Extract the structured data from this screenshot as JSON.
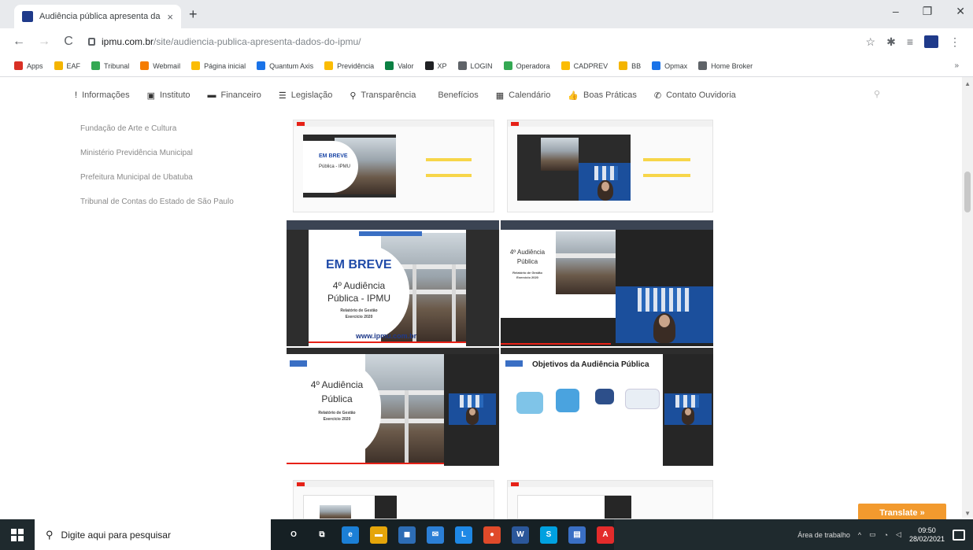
{
  "browser": {
    "tab_title": "Audiência pública apresenta da",
    "tab_close": "×",
    "new_tab": "+",
    "win_min": "–",
    "win_max": "❐",
    "win_close": "✕",
    "back": "←",
    "forward": "→",
    "reload": "C",
    "url_host": "ipmu.com.br",
    "url_path": "/site/audiencia-publica-apresenta-dados-do-ipmu/",
    "star": "☆",
    "puzzle": "✱",
    "reading": "≡",
    "menu": "⋮"
  },
  "bookmarks": [
    {
      "label": "Apps",
      "color": "#d93025"
    },
    {
      "label": "EAF",
      "color": "#f4b400"
    },
    {
      "label": "Tribunal",
      "color": "#34a853"
    },
    {
      "label": "Webmail",
      "color": "#f57c00"
    },
    {
      "label": "Página inicial",
      "color": "#fbbc04"
    },
    {
      "label": "Quantum Axis",
      "color": "#1a73e8"
    },
    {
      "label": "Previdência",
      "color": "#fbbc04"
    },
    {
      "label": "Valor",
      "color": "#0b8043"
    },
    {
      "label": "XP",
      "color": "#202124"
    },
    {
      "label": "LOGIN",
      "color": "#5f6368"
    },
    {
      "label": "Operadora",
      "color": "#34a853"
    },
    {
      "label": "CADPREV",
      "color": "#fbbc04"
    },
    {
      "label": "BB",
      "color": "#f4b400"
    },
    {
      "label": "Opmax",
      "color": "#1a73e8"
    },
    {
      "label": "Home Broker",
      "color": "#5f6368"
    }
  ],
  "bookmarks_more": "»",
  "sitenav": [
    {
      "icon": "!",
      "label": "Informações"
    },
    {
      "icon": "▣",
      "label": "Instituto"
    },
    {
      "icon": "▬",
      "label": "Financeiro"
    },
    {
      "icon": "☰",
      "label": "Legislação"
    },
    {
      "icon": "⚲",
      "label": "Transparência"
    },
    {
      "icon": "",
      "label": "Benefícios"
    },
    {
      "icon": "▦",
      "label": "Calendário"
    },
    {
      "icon": "👍",
      "label": "Boas Práticas"
    },
    {
      "icon": "✆",
      "label": "Contato  Ouvidoria"
    }
  ],
  "site_search_icon": "⚲",
  "sidebar_links": [
    "Fundação de Arte e Cultura",
    "Ministério Previdência Municipal",
    "Prefeitura Municipal de Ubatuba",
    "Tribunal de Contas do Estado de São Paulo"
  ],
  "slides": {
    "em_breve": "EM BREVE",
    "aud_ipmu_1": "4º Audiência",
    "aud_ipmu_2": "Pública - IPMU",
    "aud_pub_1": "4º Audiência",
    "aud_pub_2": "Pública",
    "relatorio_1": "Relatório de Gestão",
    "relatorio_2": "Exercício 2020",
    "site": "www.ipmu.com.br",
    "objetivos": "Objetivos da Audiência Pública"
  },
  "translate_button": "Translate »",
  "taskbar": {
    "search_placeholder": "Digite aqui para pesquisar",
    "desktop_label": "Área de trabalho",
    "time": "09:50",
    "date": "28/02/2021",
    "apps": [
      {
        "glyph": "O",
        "color": "transparent"
      },
      {
        "glyph": "⧉",
        "color": "transparent"
      },
      {
        "glyph": "e",
        "color": "#1b7fd6"
      },
      {
        "glyph": "▬",
        "color": "#e5a50a"
      },
      {
        "glyph": "◼",
        "color": "#2d6db5"
      },
      {
        "glyph": "✉",
        "color": "#2b7fd6"
      },
      {
        "glyph": "L",
        "color": "#1e88e5"
      },
      {
        "glyph": "●",
        "color": "#e04a2a"
      },
      {
        "glyph": "W",
        "color": "#2b579a"
      },
      {
        "glyph": "S",
        "color": "#00a1e0"
      },
      {
        "glyph": "▤",
        "color": "#3a6fc4"
      },
      {
        "glyph": "A",
        "color": "#e32b2b"
      }
    ]
  }
}
